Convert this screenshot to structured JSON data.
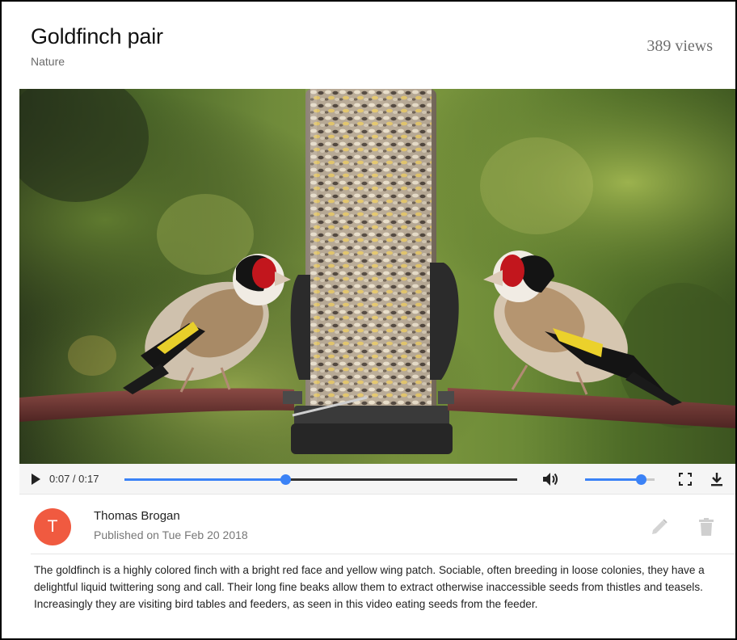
{
  "video": {
    "title": "Goldfinch pair",
    "category": "Nature",
    "views": "389 views"
  },
  "player": {
    "time_display": "0:07 / 0:17",
    "progress_fraction": 0.41,
    "volume_fraction": 0.8,
    "icons": {
      "play": "play-icon",
      "volume": "volume-icon",
      "fullscreen": "fullscreen-icon",
      "download": "download-icon"
    },
    "accent_color": "#3b82f6"
  },
  "author": {
    "initial": "T",
    "name": "Thomas Brogan",
    "published": "Published on Tue Feb 20 2018",
    "avatar_color": "#f05a40"
  },
  "actions": {
    "edit_icon": "pencil-icon",
    "delete_icon": "trash-icon"
  },
  "description": "The goldfinch is a highly colored finch with a bright red face and yellow wing patch. Sociable, often breeding in loose colonies, they have a delightful liquid twittering song and call. Their long fine beaks allow them to extract otherwise inaccessible seeds from thistles and teasels. Increasingly they are visiting bird tables and feeders, as seen in this video eating seeds from the feeder."
}
